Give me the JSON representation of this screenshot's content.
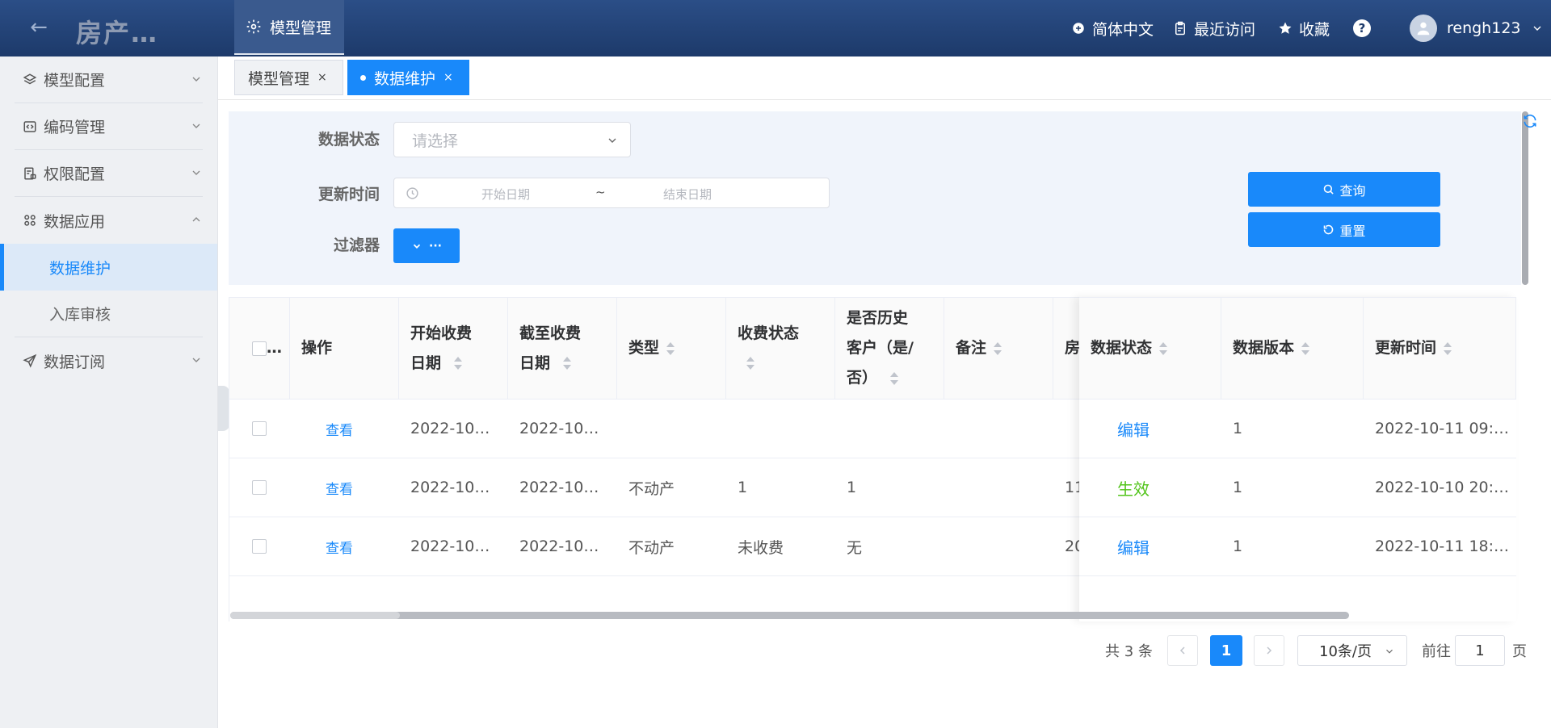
{
  "header": {
    "app_title": "房产…",
    "active_module": "模型管理",
    "language": "简体中文",
    "recent": "最近访问",
    "favorites": "收藏",
    "help": "?",
    "username": "rengh123"
  },
  "sidebar": {
    "items": [
      {
        "label": "模型配置",
        "icon": "layers-icon"
      },
      {
        "label": "编码管理",
        "icon": "code-icon"
      },
      {
        "label": "权限配置",
        "icon": "permission-icon"
      },
      {
        "label": "数据应用",
        "icon": "apps-icon"
      },
      {
        "label": "数据订阅",
        "icon": "send-icon"
      }
    ],
    "subitems": [
      {
        "label": "数据维护",
        "active": true
      },
      {
        "label": "入库审核",
        "active": false
      }
    ]
  },
  "tags": [
    {
      "label": "模型管理",
      "close": "×"
    },
    {
      "label": "数据维护",
      "close": "×",
      "active": true
    }
  ],
  "search": {
    "status_label": "数据状态",
    "status_placeholder": "请选择",
    "time_label": "更新时间",
    "start_placeholder": "开始日期",
    "range_sep": "~",
    "end_placeholder": "结束日期",
    "filter_label": "过滤器",
    "filter_more": "···",
    "query_btn": "查询",
    "reset_btn": "重置"
  },
  "table": {
    "headers": {
      "checkbox_ellipsis": "…",
      "action": "操作",
      "start_date_1": "开始收费",
      "start_date_2": "日期",
      "end_date_1": "截至收费",
      "end_date_2": "日期",
      "type": "类型",
      "fee_status": "收费状态",
      "history_1": "是否历史",
      "history_2": "客户（是/",
      "history_3": "否）",
      "remark": "备注",
      "house": "房",
      "data_status": "数据状态",
      "data_version": "数据版本",
      "update_time": "更新时间"
    },
    "rows": [
      {
        "action": "查看",
        "start": "2022-10…",
        "end": "2022-10…",
        "type": "",
        "fee_status": "",
        "history": "",
        "remark": "",
        "house": "",
        "data_status": "编辑",
        "version": "1",
        "updated": "2022-10-11 09:…"
      },
      {
        "action": "查看",
        "start": "2022-10…",
        "end": "2022-10…",
        "type": "不动产",
        "fee_status": "1",
        "history": "1",
        "remark": "",
        "house": "11",
        "data_status": "生效",
        "version": "1",
        "updated": "2022-10-10 20:…"
      },
      {
        "action": "查看",
        "start": "2022-10…",
        "end": "2022-10…",
        "type": "不动产",
        "fee_status": "未收费",
        "history": "无",
        "remark": "",
        "house": "20",
        "data_status": "编辑",
        "version": "1",
        "updated": "2022-10-11 18:…"
      }
    ]
  },
  "pagination": {
    "total": "共 3 条",
    "current_page": "1",
    "page_size": "10条/页",
    "goto_label": "前往",
    "goto_value": "1",
    "page_unit": "页"
  },
  "colors": {
    "header_bg": "#1d3a6a",
    "primary": "#1989fa",
    "active_status": "#52c41a"
  }
}
